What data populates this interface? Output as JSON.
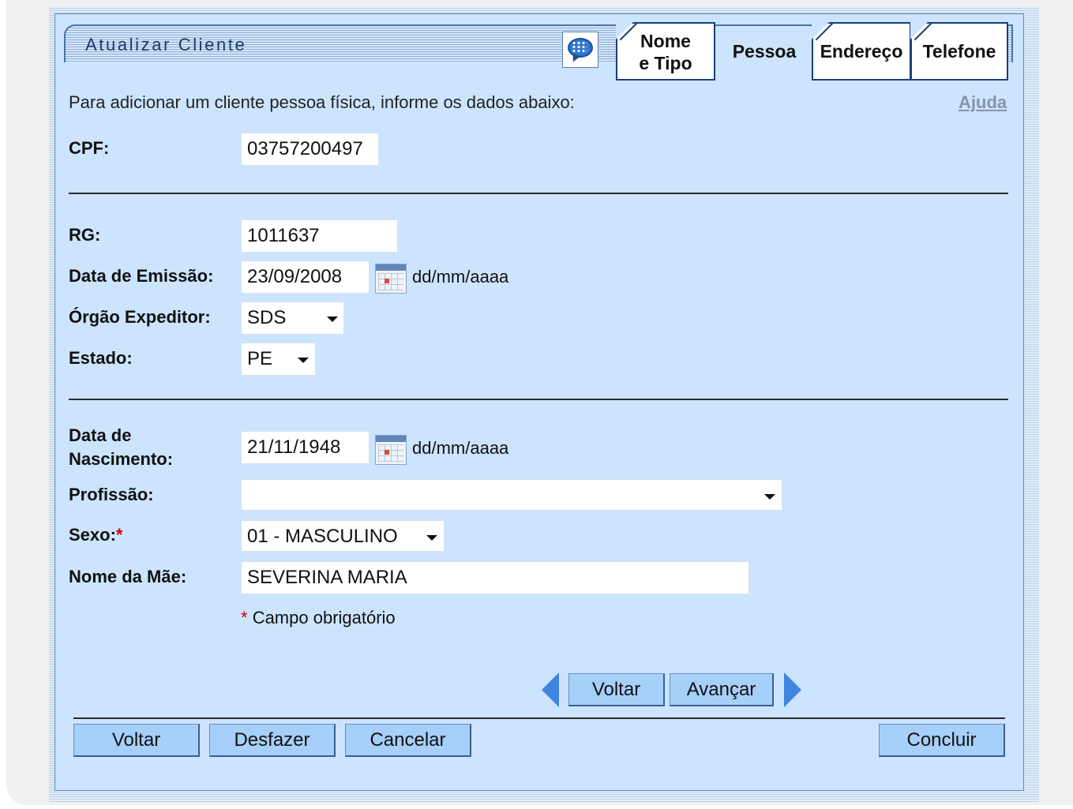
{
  "window": {
    "title": "Atualizar Cliente"
  },
  "tabs": [
    {
      "label_line1": "Nome",
      "label_line2": "e Tipo",
      "active": false
    },
    {
      "label": "Pessoa",
      "active": true
    },
    {
      "label": "Endereço",
      "active": false
    },
    {
      "label": "Telefone",
      "active": false
    }
  ],
  "intro_text": "Para adicionar um cliente pessoa física, informe os dados abaixo:",
  "help_link": "Ajuda",
  "form": {
    "cpf": {
      "label": "CPF:",
      "value": "03757200497"
    },
    "rg": {
      "label": "RG:",
      "value": "1011637"
    },
    "data_emissao": {
      "label": "Data de Emissão:",
      "value": "23/09/2008",
      "hint": "dd/mm/aaaa"
    },
    "orgao_expeditor": {
      "label": "Órgão Expeditor:",
      "value": "SDS"
    },
    "estado": {
      "label": "Estado:",
      "value": "PE"
    },
    "data_nascimento": {
      "label_line1": "Data de",
      "label_line2": "Nascimento:",
      "value": "21/11/1948",
      "hint": "dd/mm/aaaa"
    },
    "profissao": {
      "label": "Profissão:",
      "value": ""
    },
    "sexo": {
      "label": "Sexo:",
      "required_mark": "*",
      "value": "01 - MASCULINO"
    },
    "nome_mae": {
      "label": "Nome da Mãe:",
      "value": "SEVERINA MARIA"
    }
  },
  "required_note": {
    "mark": "*",
    "text": "Campo obrigatório"
  },
  "wizard_nav": {
    "back_label": "Voltar",
    "next_label": "Avançar"
  },
  "footer_buttons": {
    "back": "Voltar",
    "undo": "Desfazer",
    "cancel": "Cancelar",
    "finish": "Concluir"
  },
  "colors": {
    "panel_background": "#cce4fe",
    "button_background": "#a6cffa",
    "nav_arrow": "#3e86e0",
    "required_mark": "#d40000"
  },
  "icons": [
    "chat-bubble-icon",
    "calendar-icon",
    "dropdown-arrow-icon",
    "arrow-left-icon",
    "arrow-right-icon"
  ]
}
